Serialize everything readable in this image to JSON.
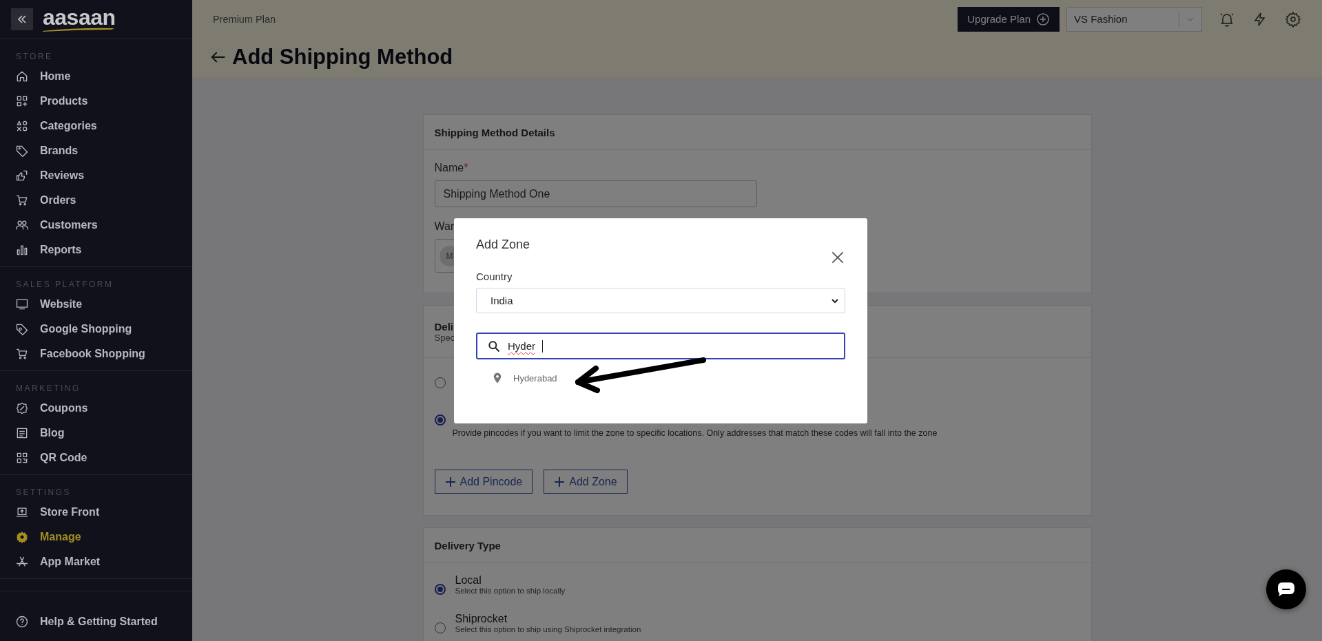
{
  "sidebar": {
    "logo": "aasaan",
    "sections": [
      {
        "title": "STORE",
        "items": [
          {
            "label": "Home",
            "selected": false
          },
          {
            "label": "Products",
            "selected": false
          },
          {
            "label": "Categories",
            "selected": false
          },
          {
            "label": "Brands",
            "selected": false
          },
          {
            "label": "Reviews",
            "selected": false
          },
          {
            "label": "Orders",
            "selected": false
          },
          {
            "label": "Customers",
            "selected": false
          },
          {
            "label": "Reports",
            "selected": false
          }
        ]
      },
      {
        "title": "SALES PLATFORM",
        "items": [
          {
            "label": "Website",
            "selected": false
          },
          {
            "label": "Google Shopping",
            "selected": false
          },
          {
            "label": "Facebook Shopping",
            "selected": false
          }
        ]
      },
      {
        "title": "MARKETING",
        "items": [
          {
            "label": "Coupons",
            "selected": false
          },
          {
            "label": "Blog",
            "selected": false
          },
          {
            "label": "QR Code",
            "selected": false
          }
        ]
      },
      {
        "title": "SETTINGS",
        "items": [
          {
            "label": "Store Front",
            "selected": false
          },
          {
            "label": "Manage",
            "selected": true
          },
          {
            "label": "App Market",
            "selected": false
          }
        ]
      }
    ],
    "footer_item": {
      "label": "Help & Getting Started"
    }
  },
  "header": {
    "plan": "Premium Plan",
    "upgrade_button": "Upgrade Plan",
    "store_select": "VS Fashion",
    "page_title": "Add Shipping Method"
  },
  "details_card": {
    "title": "Shipping Method Details",
    "name_label": "Name",
    "required_mark": "*",
    "name_value": "Shipping Method One",
    "warehouse_label": "War",
    "warehouse_chip": "M"
  },
  "zones_card": {
    "title": "Deli",
    "subtitle": "Spec",
    "options": [
      {
        "selected": false
      },
      {
        "selected": true,
        "description": "Provide pincodes if you want to limit the zone to specific locations. Only addresses that match these codes will fall into the zone"
      }
    ],
    "buttons": [
      {
        "label": "Add Pincode"
      },
      {
        "label": "Add Zone"
      }
    ]
  },
  "delivery_card": {
    "title": "Delivery Type",
    "options": [
      {
        "label": "Local",
        "description": "Select this option to ship locally",
        "selected": true
      },
      {
        "label": "Shiprocket",
        "description": "Select this option to ship using Shiprocket integration",
        "selected": false
      }
    ]
  },
  "modal": {
    "title": "Add Zone",
    "country_label": "Country",
    "country_value": "India",
    "search_value": "Hyder",
    "suggestions": [
      {
        "label": "Hyderabad"
      }
    ]
  }
}
